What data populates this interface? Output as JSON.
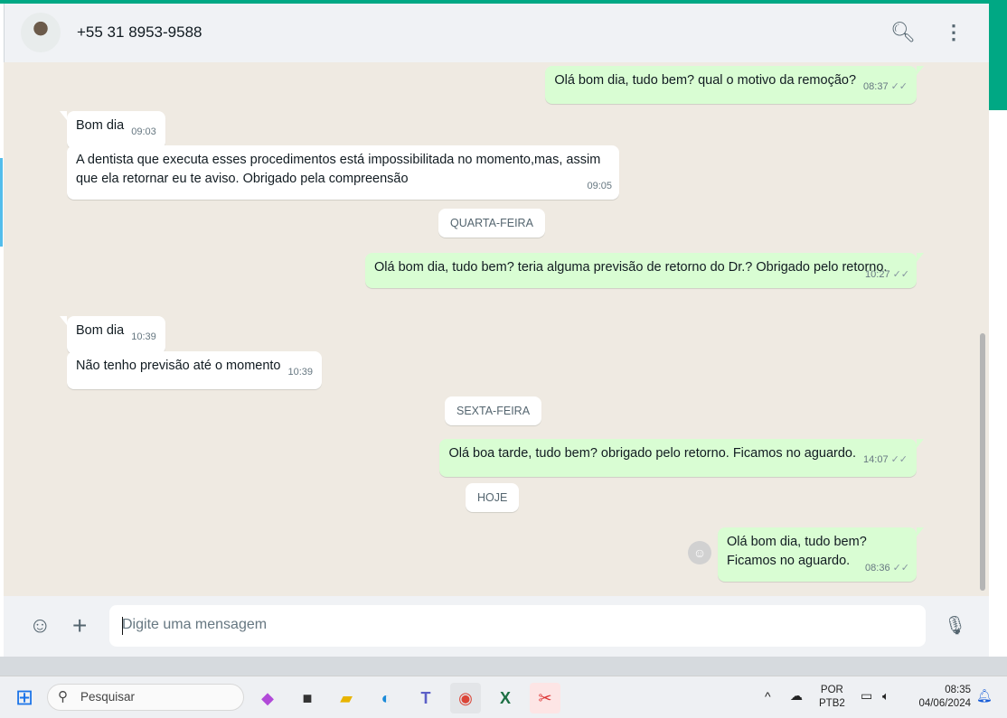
{
  "header": {
    "contact": "+55 31 8953-9588"
  },
  "messages": [
    {
      "dir": "out",
      "text": "Olá bom dia, tudo bem? qual o motivo da remoção?",
      "time": "08:37"
    },
    {
      "dir": "in",
      "text": "Bom dia",
      "time": "09:03"
    },
    {
      "dir": "in",
      "text": "A dentista que executa esses procedimentos está impossibilitada no momento,mas, assim que ela retornar eu te aviso. Obrigado pela compreensão",
      "time": "09:05"
    },
    {
      "dir": "out",
      "text": "Olá bom dia, tudo bem? teria alguma previsão de retorno do Dr.? Obrigado pelo retorno.",
      "time": "10:27"
    },
    {
      "dir": "in",
      "text": "Bom dia",
      "time": "10:39"
    },
    {
      "dir": "in",
      "text": "Não tenho previsão até o momento",
      "time": "10:39"
    },
    {
      "dir": "out",
      "text": "Olá boa tarde, tudo bem? obrigado pelo retorno. Ficamos no aguardo.",
      "time": "14:07"
    },
    {
      "dir": "out",
      "text": "Olá bom dia, tudo bem? Ficamos no aguardo.",
      "time": "08:36"
    }
  ],
  "days": [
    "QUARTA-FEIRA",
    "SEXTA-FEIRA",
    "HOJE"
  ],
  "footer": {
    "placeholder": "Digite uma mensagem"
  },
  "taskbar": {
    "search": "Pesquisar",
    "lang1": "POR",
    "lang2": "PTB2",
    "time": "08:35",
    "date": "04/06/2024"
  }
}
